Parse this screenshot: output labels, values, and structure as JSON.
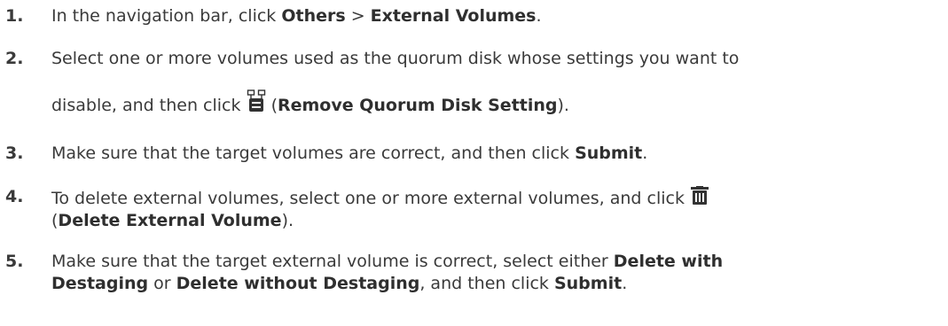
{
  "steps": [
    {
      "number": "1.",
      "text_1": "In the navigation bar, click ",
      "bold_1": "Others",
      "text_2": " > ",
      "bold_2": "External Volumes",
      "text_3": "."
    },
    {
      "number": "2.",
      "text_1": "Select one or more volumes used as the quorum disk whose settings you want to",
      "text_2": "disable, and then click ",
      "text_3": " (",
      "bold_1": "Remove Quorum Disk Setting",
      "text_4": ").",
      "icon": "remove-quorum-disk-icon"
    },
    {
      "number": "3.",
      "text_1": "Make sure that the target volumes are correct, and then click ",
      "bold_1": "Submit",
      "text_2": "."
    },
    {
      "number": "4.",
      "text_1": "To delete external volumes, select one or more external volumes, and click ",
      "text_2": "(",
      "bold_1": "Delete External Volume",
      "text_3": ").",
      "icon": "trash-icon"
    },
    {
      "number": "5.",
      "text_1": "Make sure that the target external volume is correct, select either ",
      "bold_1": "Delete with",
      "bold_2": "Destaging",
      "text_2": " or ",
      "bold_3": "Delete without Destaging",
      "text_3": ", and then click ",
      "bold_4": "Submit",
      "text_4": "."
    }
  ]
}
